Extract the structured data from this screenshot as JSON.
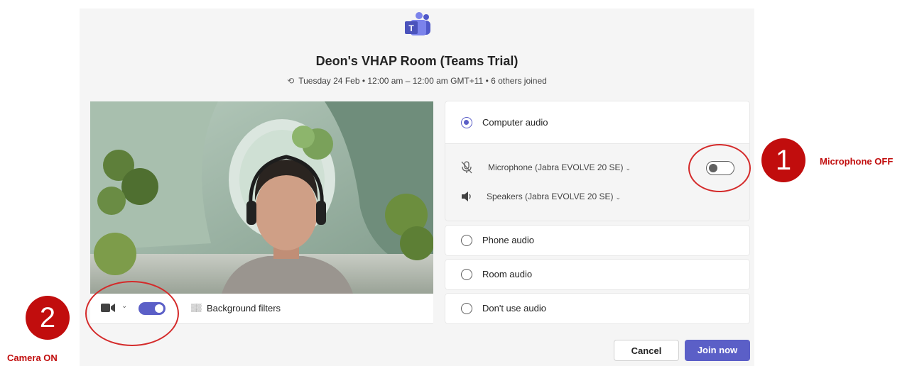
{
  "meeting": {
    "title": "Deon's VHAP Room (Teams Trial)",
    "schedule": "Tuesday 24 Feb • 12:00 am – 12:00 am GMT+11 • 6 others joined"
  },
  "video_bar": {
    "camera_toggle": "on",
    "background_filters_label": "Background filters"
  },
  "audio": {
    "options": {
      "computer": "Computer audio",
      "phone": "Phone audio",
      "room": "Room audio",
      "none": "Don't use audio"
    },
    "selected": "computer",
    "microphone_label": "Microphone (Jabra EVOLVE 20 SE)",
    "microphone_toggle": "off",
    "speakers_label": "Speakers (Jabra EVOLVE 20 SE)"
  },
  "actions": {
    "cancel": "Cancel",
    "join": "Join now"
  },
  "annotations": {
    "mic": {
      "number": "1",
      "label": "Microphone OFF"
    },
    "camera": {
      "number": "2",
      "label": "Camera ON"
    },
    "color": "#c10d0d"
  },
  "colors": {
    "accent": "#5b5fc7",
    "annotation": "#c10d0d"
  },
  "icons": [
    "teams-logo-icon",
    "recurring-icon",
    "camera-icon",
    "chevron-down-icon",
    "background-filter-icon",
    "mic-off-icon",
    "speaker-icon"
  ]
}
